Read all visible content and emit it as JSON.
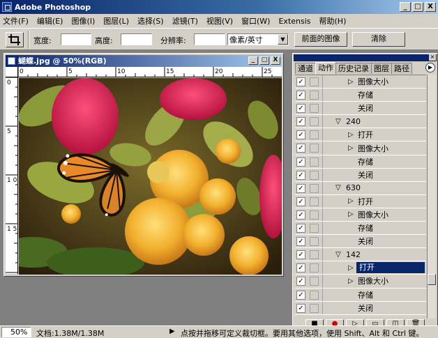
{
  "window": {
    "title": "Adobe Photoshop",
    "controls": [
      "_",
      "□",
      "X"
    ]
  },
  "menu": [
    "文件(F)",
    "编辑(E)",
    "图像(I)",
    "图层(L)",
    "选择(S)",
    "滤镜(T)",
    "视图(V)",
    "窗口(W)",
    "Extensis",
    "帮助(H)"
  ],
  "options": {
    "width_label": "宽度:",
    "width_value": "",
    "height_label": "高度:",
    "height_value": "",
    "resolution_label": "分辨率:",
    "resolution_value": "",
    "unit_selected": "像素/英寸",
    "front_image_button": "前面的图像",
    "clear_button": "清除"
  },
  "document": {
    "title": "蝴蝶.jpg @ 50%(RGB)",
    "hruler_ticks": [
      "0",
      "5",
      "10",
      "15",
      "20",
      "25"
    ],
    "vruler_ticks": [
      "0",
      "5",
      "1 0",
      "1 5"
    ]
  },
  "panel": {
    "tabs": [
      "通道",
      "动作",
      "历史记录",
      "图层",
      "路径"
    ],
    "active_tab": "动作",
    "rows": [
      {
        "kind": "item",
        "label": "图像大小",
        "expand": "▷"
      },
      {
        "kind": "step",
        "label": "存储",
        "expand": ""
      },
      {
        "kind": "step",
        "label": "关闭",
        "expand": ""
      },
      {
        "kind": "set",
        "label": "240",
        "expand": "▽"
      },
      {
        "kind": "item",
        "label": "打开",
        "expand": "▷"
      },
      {
        "kind": "item",
        "label": "图像大小",
        "expand": "▷"
      },
      {
        "kind": "step",
        "label": "存储",
        "expand": ""
      },
      {
        "kind": "step",
        "label": "关闭",
        "expand": ""
      },
      {
        "kind": "set",
        "label": "630",
        "expand": "▽"
      },
      {
        "kind": "item",
        "label": "打开",
        "expand": "▷"
      },
      {
        "kind": "item",
        "label": "图像大小",
        "expand": "▷"
      },
      {
        "kind": "step",
        "label": "存储",
        "expand": ""
      },
      {
        "kind": "step",
        "label": "关闭",
        "expand": ""
      },
      {
        "kind": "set",
        "label": "142",
        "expand": "▽"
      },
      {
        "kind": "item",
        "label": "打开",
        "expand": "▷",
        "selected": true
      },
      {
        "kind": "item",
        "label": "图像大小",
        "expand": "▷"
      },
      {
        "kind": "step",
        "label": "存储",
        "expand": ""
      },
      {
        "kind": "step",
        "label": "关闭",
        "expand": ""
      }
    ],
    "check": "✓",
    "footer_icons": [
      "stop-icon",
      "record-icon",
      "play-icon",
      "new-set-icon",
      "new-action-icon",
      "trash-icon"
    ]
  },
  "status": {
    "zoom": "50%",
    "doc_info": "文档:1.38M/1.38M",
    "hint": "点按并拖移可定义裁切框。要用其他选项，使用 Shift、Alt 和 Ctrl 键。"
  }
}
